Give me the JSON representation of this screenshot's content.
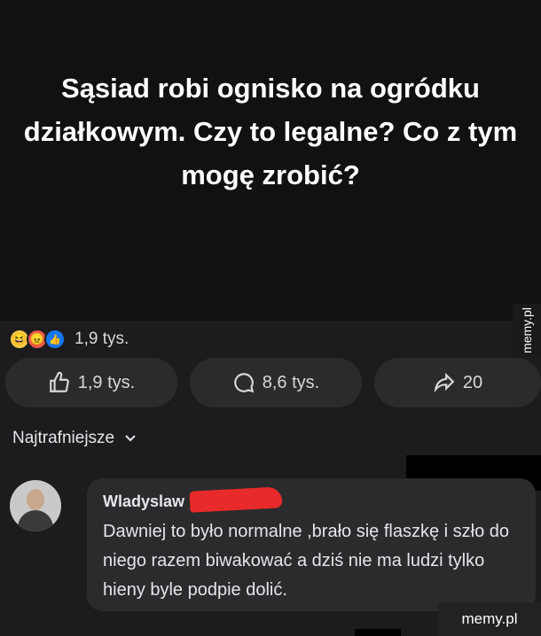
{
  "post": {
    "text": "Sąsiad robi ognisko na ogródku działkowym. Czy to legalne? Co z tym mogę zrobić?"
  },
  "reactions": {
    "count": "1,9 tys.",
    "icons": [
      "haha-emoji",
      "angry-emoji",
      "like-emoji"
    ]
  },
  "actions": {
    "like_count": "1,9 tys.",
    "comment_count": "8,6 tys.",
    "share_count": "20"
  },
  "comments_sort": {
    "label": "Najtrafniejsze"
  },
  "comment": {
    "author": "Wladyslaw",
    "text": "Dawniej to było normalne ,brało się flaszkę i szło do niego razem biwakować a dziś nie ma ludzi tylko hieny byle podpie dolić."
  },
  "watermark": {
    "side": "memy.pl",
    "bottom": "memy.pl"
  },
  "colors": {
    "post_background": "#111111",
    "page_background": "#1c1c1e",
    "pill_background": "#2b2b2e",
    "redaction": "#e82a2a"
  }
}
